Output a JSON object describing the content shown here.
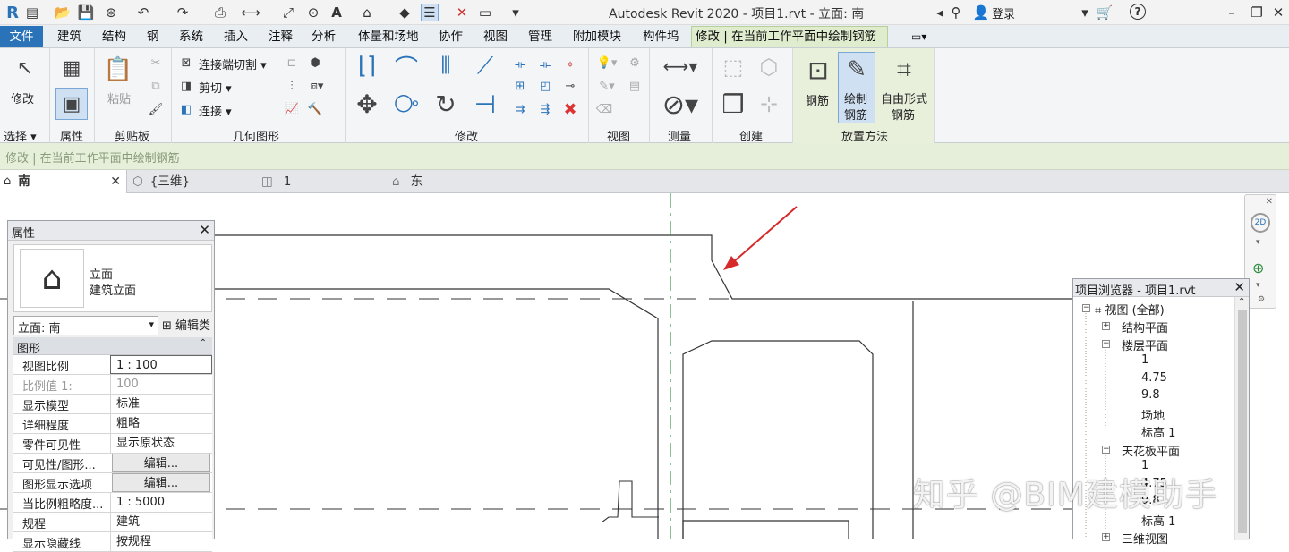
{
  "title_bar": {
    "title": "Autodesk Revit 2020 - 项目1.rvt - 立面: 南",
    "login": "登录",
    "app_logo": "R"
  },
  "menu_tabs": [
    "文件",
    "建筑",
    "结构",
    "钢",
    "系统",
    "插入",
    "注释",
    "分析",
    "体量和场地",
    "协作",
    "视图",
    "管理",
    "附加模块",
    "构件坞"
  ],
  "context_tab": "修改 | 在当前工作平面中绘制钢筋",
  "ribbon": {
    "modify_label": "修改",
    "select_label": "选择",
    "properties_label": "属性",
    "paste_label": "粘贴",
    "clipboard_label": "剪贴板",
    "join_cut": "连接端切割",
    "cut": "剪切",
    "join": "连接",
    "geometry_label": "几何图形",
    "modify_panel_label": "修改",
    "view_label": "视图",
    "measure_label": "测量",
    "create_label": "创建",
    "rebar": "钢筋",
    "draw_rebar_1": "绘制",
    "draw_rebar_2": "钢筋",
    "freeform_1": "自由形式",
    "freeform_2": "钢筋",
    "placement_label": "放置方法"
  },
  "options_bar": "修改 | 在当前工作平面中绘制钢筋",
  "view_tabs": [
    {
      "label": "南",
      "active": true
    },
    {
      "label": "{三维}",
      "active": false
    },
    {
      "label": "1",
      "active": false
    },
    {
      "label": "东",
      "active": false
    }
  ],
  "properties": {
    "title": "属性",
    "type_line1": "立面",
    "type_line2": "建筑立面",
    "selector": "立面: 南",
    "edit_type": "编辑类",
    "group": "图形",
    "rows": [
      {
        "k": "视图比例",
        "v": "1 : 100",
        "kind": "input"
      },
      {
        "k": "比例值 1:",
        "v": "100",
        "kind": "dim"
      },
      {
        "k": "显示模型",
        "v": "标准",
        "kind": "text"
      },
      {
        "k": "详细程度",
        "v": "粗略",
        "kind": "text"
      },
      {
        "k": "零件可见性",
        "v": "显示原状态",
        "kind": "text"
      },
      {
        "k": "可见性/图形...",
        "v": "编辑...",
        "kind": "btn"
      },
      {
        "k": "图形显示选项",
        "v": "编辑...",
        "kind": "btn"
      },
      {
        "k": "当比例粗略度...",
        "v": "1 : 5000",
        "kind": "text"
      },
      {
        "k": "规程",
        "v": "建筑",
        "kind": "text"
      },
      {
        "k": "显示隐藏线",
        "v": "按规程",
        "kind": "text"
      }
    ]
  },
  "browser": {
    "title": "项目浏览器 - 项目1.rvt",
    "root": "视图 (全部)",
    "structural_plans": "结构平面",
    "floor_plans": "楼层平面",
    "floor_items": [
      "1",
      "4.75",
      "9.8",
      "场地",
      "标高 1"
    ],
    "ceiling_plans": "天花板平面",
    "ceiling_items": [
      "1",
      "4.75",
      "9.8",
      "标高 1"
    ],
    "three_d": "三维视图"
  },
  "watermark": "知乎 @BIM建模助手",
  "colors": {
    "accent": "#2b73b8",
    "context": "#dfeccd",
    "arrow": "#d62a2a",
    "grid": "#2e8b3e"
  }
}
